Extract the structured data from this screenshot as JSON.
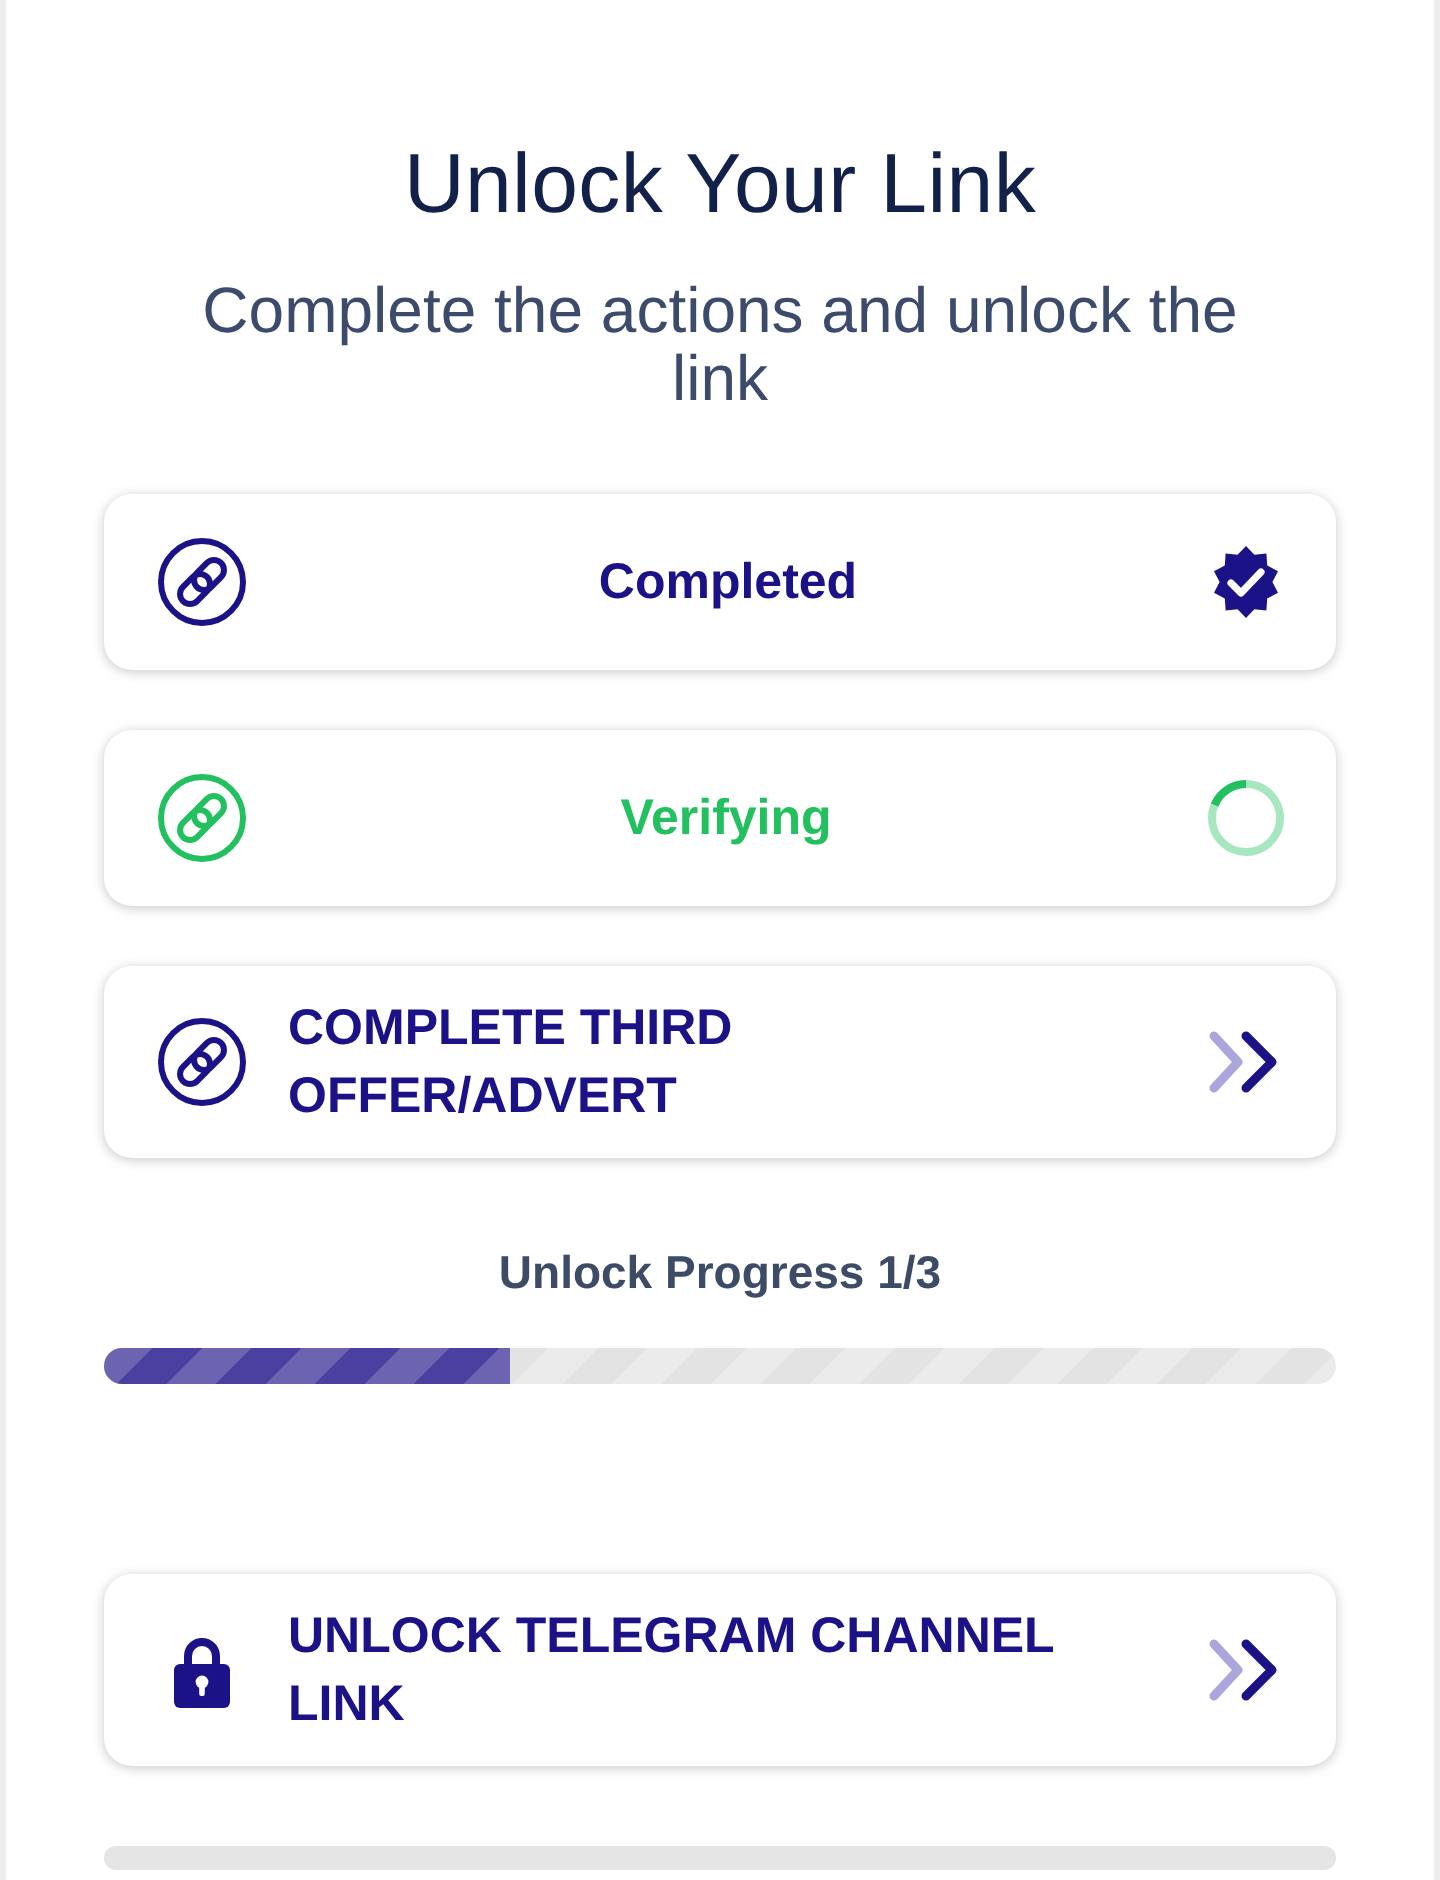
{
  "header": {
    "title": "Unlock Your Link",
    "subtitle": "Complete the actions and unlock the link"
  },
  "tasks": [
    {
      "kind": "completed",
      "label": "Completed"
    },
    {
      "kind": "verifying",
      "label": "Verifying"
    },
    {
      "kind": "offer",
      "label": "COMPLETE THIRD OFFER/ADVERT"
    }
  ],
  "progress": {
    "label": "Unlock Progress 1/3",
    "level": 0.33
  },
  "unlock": {
    "kind": "locked",
    "label": "UNLOCK TELEGRAM CHANNEL LINK"
  },
  "bottom_bar": {
    "level": 0
  }
}
